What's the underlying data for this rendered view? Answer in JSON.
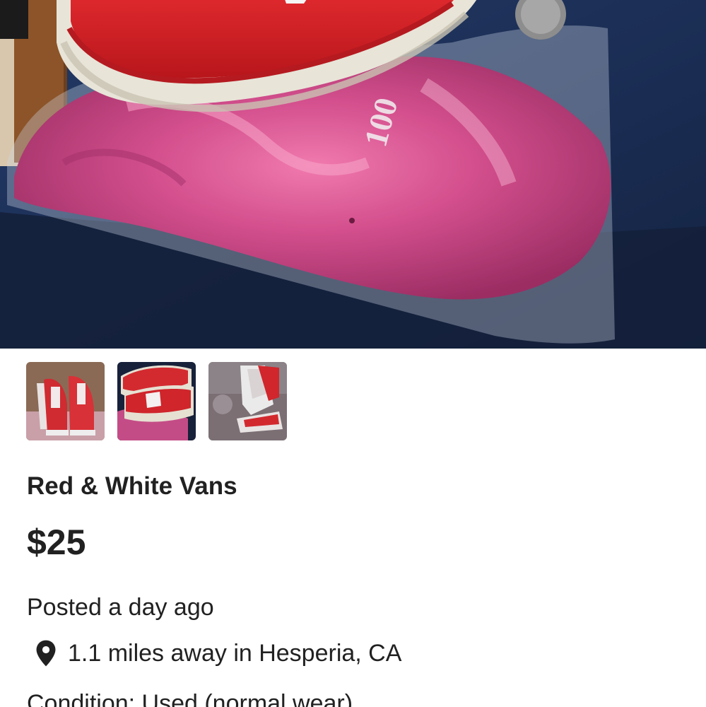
{
  "listing": {
    "title": "Red & White Vans",
    "price": "$25",
    "posted": "Posted a day ago",
    "location": "1.1 miles away in Hesperia, CA",
    "condition": "Condition: Used (normal wear)"
  },
  "photos": {
    "main_photo_text": "100",
    "thumbnail_count": 3
  },
  "icons": {
    "location": "map-pin-icon"
  },
  "colors": {
    "text": "#212121",
    "background": "#ffffff",
    "shoe_red": "#d01f24",
    "bag_pink": "#c8437f"
  }
}
